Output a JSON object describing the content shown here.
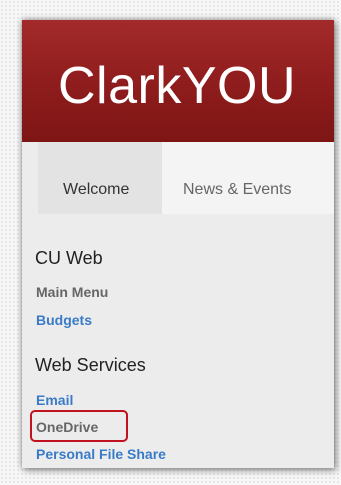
{
  "banner": {
    "brand": "ClarkYOU"
  },
  "tabs": [
    {
      "label": "Welcome",
      "active": true
    },
    {
      "label": "News & Events",
      "active": false
    }
  ],
  "sections": {
    "cu_web": {
      "title": "CU Web",
      "links": [
        {
          "label": "Main Menu"
        },
        {
          "label": "Budgets"
        }
      ]
    },
    "web_services": {
      "title": "Web Services",
      "links": [
        {
          "label": "Email"
        },
        {
          "label": "OneDrive"
        },
        {
          "label": "Personal File Share"
        }
      ]
    }
  },
  "colors": {
    "banner": "#8e1c1c",
    "link_blue": "#3a7bc8",
    "link_gray": "#666666",
    "highlight": "#c0121f"
  }
}
